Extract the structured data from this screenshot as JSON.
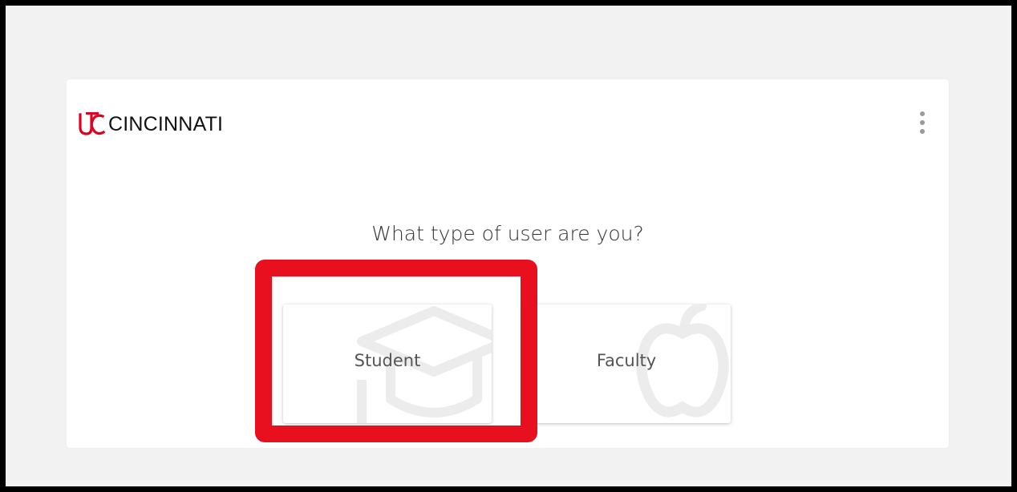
{
  "header": {
    "logo_text": "CINCINNATI",
    "logo_color": "#e00122"
  },
  "prompt": {
    "question": "What type of user are you?"
  },
  "choices": [
    {
      "label": "Student",
      "icon": "graduation-cap-icon"
    },
    {
      "label": "Faculty",
      "icon": "apple-icon"
    }
  ],
  "highlight": {
    "color": "#e8101f",
    "target": "Student"
  }
}
